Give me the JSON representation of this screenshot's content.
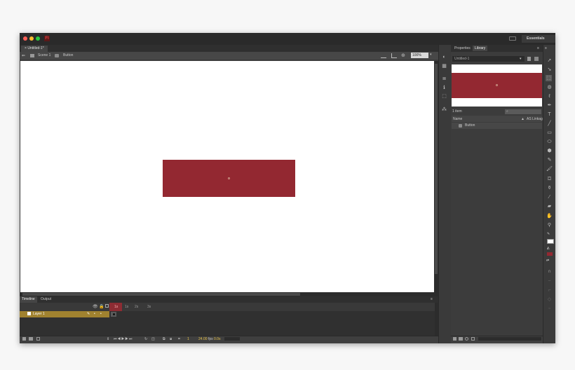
{
  "titlebar": {
    "app_icon": "Fl",
    "workspace": "Essentials"
  },
  "document": {
    "tab": "Untitled-1*",
    "scene": "Scene 1",
    "symbol": "Button",
    "zoom": "100%"
  },
  "timeline": {
    "tabs": [
      "Timeline",
      "Output"
    ],
    "frame_labels": [
      "1s",
      "1s",
      "2s",
      "3s"
    ],
    "layer_name": "Layer 1",
    "current_frame": "1",
    "fps": "24.00",
    "fps_unit": "fps",
    "elapsed": "0.0s"
  },
  "library": {
    "tabs": [
      "Properties",
      "Library"
    ],
    "document": "Untitled-1",
    "count": "1 item",
    "col_name": "Name",
    "col_linkage": "AS Linkag",
    "item": "Button"
  },
  "colors": {
    "symbol_fill": "#932831",
    "layer_highlight": "#a0822f",
    "playhead": "#8d2c33"
  },
  "icons": {
    "tools": [
      "selection-arrow",
      "subselection-arrow",
      "free-transform",
      "3d-rotation",
      "lasso",
      "pen",
      "text",
      "line",
      "rectangle",
      "oval",
      "polystar",
      "pencil",
      "brush",
      "paint-bucket",
      "ink-bottle",
      "eyedropper",
      "eraser",
      "hand",
      "zoom"
    ]
  }
}
